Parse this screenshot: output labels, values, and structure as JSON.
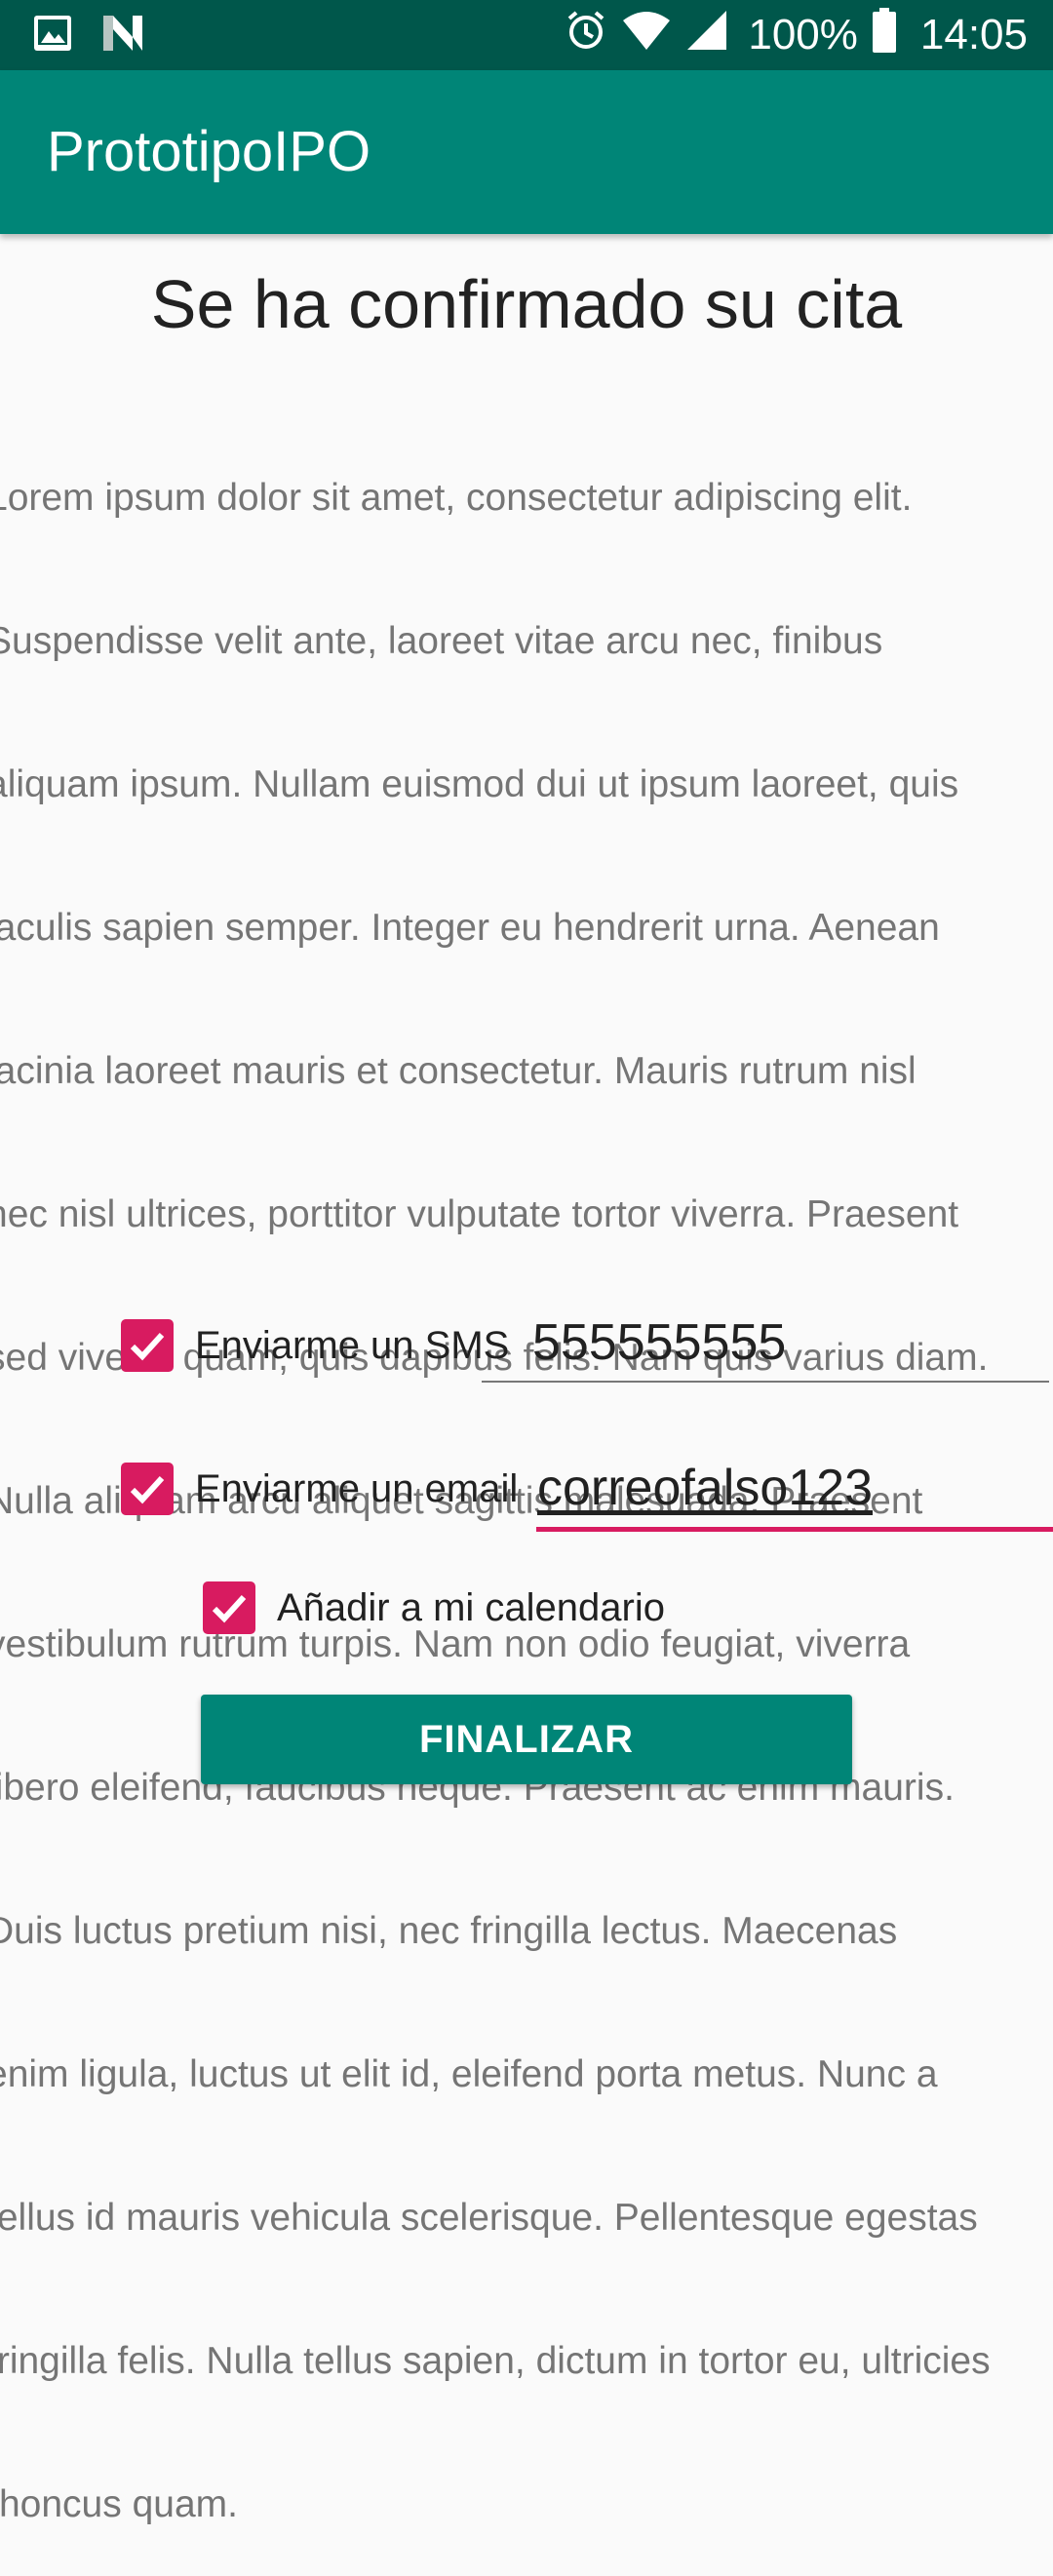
{
  "status_bar": {
    "left_icons": [
      "image-icon",
      "n-notification-icon"
    ],
    "right_icons": [
      "alarm-icon",
      "wifi-icon",
      "signal-icon",
      "battery-icon"
    ],
    "battery": "100%",
    "time": "14:05"
  },
  "app_bar": {
    "title": "PrototipoIPO"
  },
  "content": {
    "heading": "Se ha confirmado su cita",
    "body_lines": [
      "Lorem ipsum dolor sit amet, consectetur adipiscing elit.",
      "Suspendisse velit ante, laoreet vitae arcu nec, finibus",
      "aliquam ipsum. Nullam euismod dui ut ipsum laoreet, quis",
      "iaculis sapien semper. Integer eu hendrerit urna. Aenean",
      "lacinia laoreet mauris et consectetur. Mauris rutrum nisl",
      "nec nisl ultrices, porttitor vulputate tortor viverra. Praesent",
      "sed viverra quam, quis dapibus felis. Nam quis varius diam.",
      "Nulla aliquam arcu aliquet sagittis malesuada. Praesent",
      "vestibulum rutrum turpis. Nam non odio feugiat, viverra",
      "libero eleifend, faucibus neque. Praesent ac enim mauris.",
      "Duis luctus pretium nisi, nec fringilla lectus. Maecenas",
      "enim ligula, luctus ut elit id, eleifend porta metus. Nunc a",
      "tellus id mauris vehicula scelerisque. Pellentesque egestas",
      "fringilla felis. Nulla tellus sapien, dictum in tortor eu, ultricies",
      "rhoncus quam."
    ]
  },
  "options": {
    "sms": {
      "label": "Enviarme un SMS",
      "checked": true,
      "value": "555555555"
    },
    "email": {
      "label": "Enviarme un email",
      "checked": true,
      "value": "correofalso123"
    },
    "calendar": {
      "label": "Añadir a mi calendario",
      "checked": true
    }
  },
  "actions": {
    "finish_label": "FINALIZAR"
  },
  "colors": {
    "status_bar": "#00574b",
    "primary": "#008577",
    "accent": "#d81b60",
    "background": "#fafafa"
  }
}
